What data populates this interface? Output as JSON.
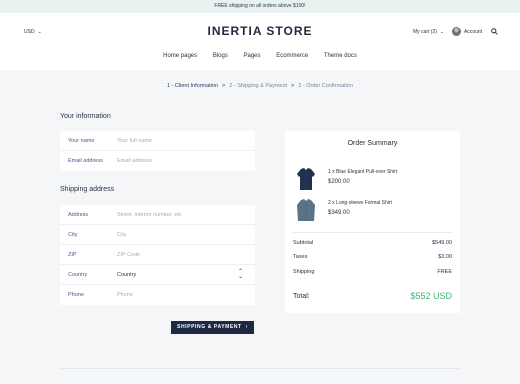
{
  "announcement": "FREE shipping on all orders above $100!",
  "header": {
    "currency": "USD",
    "logo": "INERTIA STORE",
    "cart": "My cart (2)",
    "account": "Account"
  },
  "nav": [
    "Home pages",
    "Blogs",
    "Pages",
    "Ecommerce",
    "Theme docs"
  ],
  "breadcrumb": {
    "step1": "1 - Client Information",
    "step2": "2 - Shipping & Payment",
    "step3": "3 - Order Confirmation",
    "separator": ">"
  },
  "your_information": {
    "title": "Your information",
    "fields": [
      {
        "label": "Your name",
        "placeholder": "Your full name"
      },
      {
        "label": "Email address",
        "placeholder": "Email address"
      }
    ]
  },
  "shipping_address": {
    "title": "Shipping address",
    "fields": [
      {
        "label": "Address",
        "placeholder": "Street, interior number, etc"
      },
      {
        "label": "City",
        "placeholder": "City"
      },
      {
        "label": "ZIP",
        "placeholder": "ZIP Code"
      },
      {
        "label": "Country",
        "value": "Country"
      },
      {
        "label": "Phone",
        "placeholder": "Phone"
      }
    ]
  },
  "cta": {
    "label": "SHIPPING & PAYMENT"
  },
  "order_summary": {
    "title": "Order Summary",
    "items": [
      {
        "name": "1 x Blue Elegant Pull-over Shirt",
        "price": "$200.00",
        "color": "#1f3150"
      },
      {
        "name": "2 x Long-sleeve Formal Shirt",
        "price": "$349.00",
        "color": "#5a7389"
      }
    ],
    "subtotal": {
      "label": "Subtotal",
      "value": "$549.00"
    },
    "taxes": {
      "label": "Taxes",
      "value": "$3.00"
    },
    "shipping": {
      "label": "Shipping",
      "value": "FREE"
    },
    "total": {
      "label": "Total:",
      "value": "$552 USD"
    }
  },
  "colors": {
    "accent": "#3fb87a",
    "button": "#1e2a44",
    "topbar": "#e6f3f1"
  }
}
